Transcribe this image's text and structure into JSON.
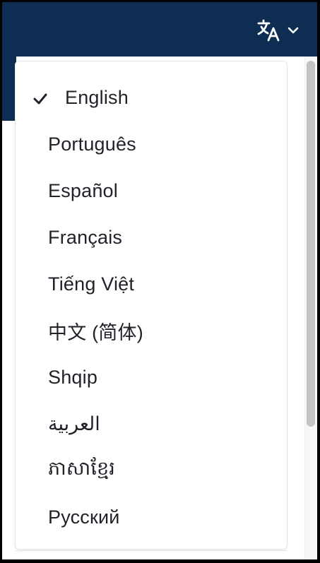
{
  "header": {
    "language_icon": "translate-icon",
    "dropdown_icon": "chevron-down-icon",
    "background_color": "#0f2d52"
  },
  "menu": {
    "selected_icon": "check-icon",
    "items": [
      {
        "label": "English",
        "selected": true
      },
      {
        "label": "Português",
        "selected": false
      },
      {
        "label": "Español",
        "selected": false
      },
      {
        "label": "Français",
        "selected": false
      },
      {
        "label": "Tiếng Việt",
        "selected": false
      },
      {
        "label": "中文 (简体)",
        "selected": false
      },
      {
        "label": "Shqip",
        "selected": false
      },
      {
        "label": "العربية",
        "selected": false
      },
      {
        "label": "ភាសាខ្មែរ",
        "selected": false
      },
      {
        "label": "Русский",
        "selected": false
      }
    ]
  }
}
